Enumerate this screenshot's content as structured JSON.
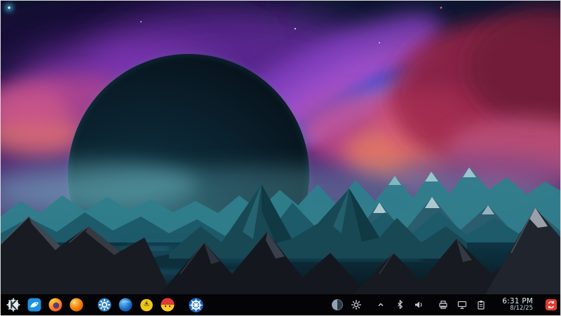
{
  "desktop": {
    "wallpaper_alt": "Dark eclipsed planet rising over glowing teal mountains and a lake, under purple, violet and crimson nebula clouds"
  },
  "taskbar": {
    "background": "#040407",
    "launcher_icons": [
      {
        "name": "app-launcher-kde-icon",
        "color": "#e8ebee"
      },
      {
        "name": "file-manager-icon",
        "color": "#1b8fe0"
      },
      {
        "name": "firefox-icon",
        "color": "#ff8a1e"
      },
      {
        "name": "orange-sphere-app-icon",
        "color": "#f57c00"
      },
      {
        "name": "system-settings-gear-icon",
        "color": "#2f83c7"
      },
      {
        "name": "blue-globe-browser-icon",
        "color": "#1565c0"
      },
      {
        "name": "yellow-mascot-icon",
        "color": "#f5c518"
      },
      {
        "name": "red-yellow-mascot-icon",
        "color": "#e53935"
      },
      {
        "name": "ship-wheel-icon",
        "color": "#1565c0"
      }
    ],
    "tray_icons": [
      {
        "name": "half-moon-icon"
      },
      {
        "name": "gear-icon"
      },
      {
        "name": "expander-caret-icon"
      },
      {
        "name": "bluetooth-icon"
      },
      {
        "name": "volume-icon"
      },
      {
        "name": "printer-icon"
      },
      {
        "name": "display-icon"
      },
      {
        "name": "clipboard-icon"
      }
    ],
    "clock": {
      "time": "6:31 PM",
      "date": "8/12/25"
    },
    "notifier": {
      "name": "updates-notifier-icon",
      "color": "#e23a2e"
    }
  }
}
